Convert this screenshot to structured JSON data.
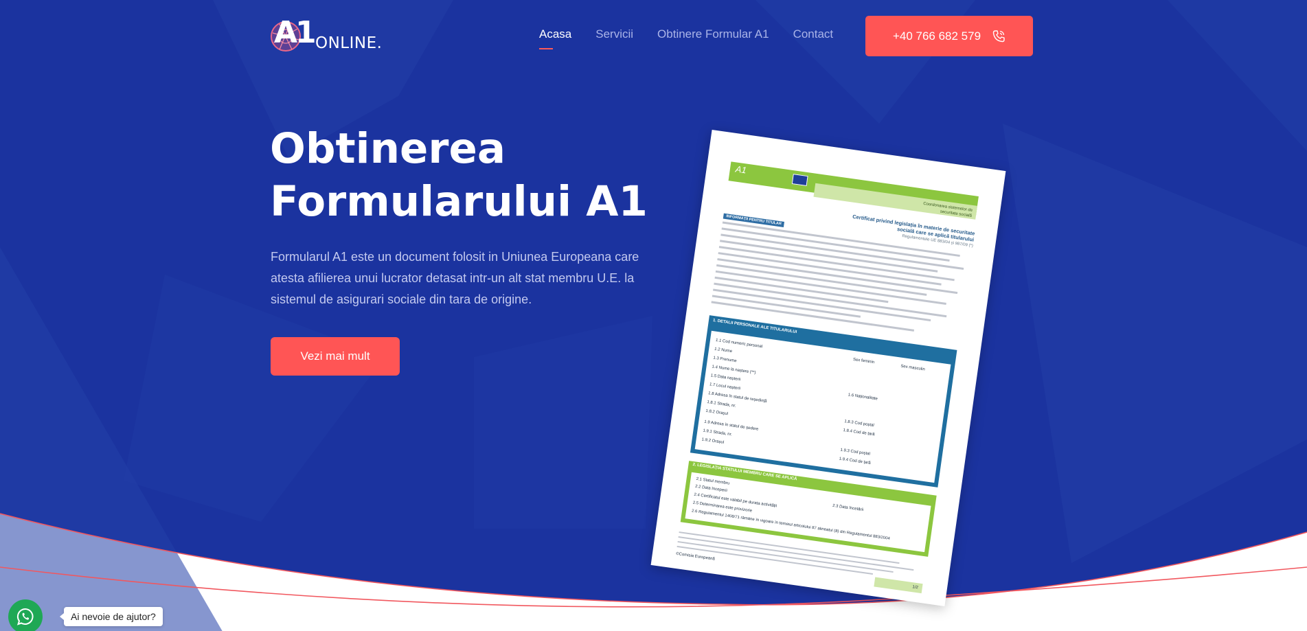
{
  "brand": {
    "logo_main": "A1",
    "logo_sub": "ONLINE."
  },
  "nav": {
    "items": [
      {
        "label": "Acasa",
        "active": true
      },
      {
        "label": "Servicii",
        "active": false
      },
      {
        "label": "Obtinere Formular A1",
        "active": false
      },
      {
        "label": "Contact",
        "active": false
      }
    ]
  },
  "header": {
    "phone": "+40 766 682 579",
    "phone_icon": "phone-icon"
  },
  "hero": {
    "title_line1": "Obtinerea",
    "title_line2": "Formularului A1",
    "description": "Formularul A1 este un document folosit in Uniunea Europeana care atesta afilierea unui lucrator detasat intr-un alt stat membru U.E. la sistemul de asigurari sociale din tara de origine.",
    "cta": "Vezi mai mult"
  },
  "document": {
    "form_code": "A1",
    "coord": "Coordonarea sistemelor de securitate socială",
    "title": "Certificat privind legislația în materie de securitate socială care se aplică titularului",
    "regulation": "Regulamentele UE 883/04 și 987/09 (*)",
    "info_label": "INFORMAȚII PENTRU TITULAR",
    "section1": "1. DETALII PERSONALE ALE TITULARULUI",
    "section1_fields": [
      "1.1 Cod numeric personal",
      "1.2 Nume",
      "1.3 Prenume",
      "1.4 Nume la naștere (**)",
      "1.5 Data nașterii",
      "1.7 Locul nașterii",
      "1.8 Adresa în statul de reședință",
      "1.8.1 Strada, nr.",
      "1.8.2 Orașul",
      "1.9 Adresa în statul de ședere",
      "1.9.1 Strada, nr.",
      "1.9.2 Orașul"
    ],
    "section1_right": [
      "Sex feminin",
      "Sex masculin",
      "1.6 Naționalitate",
      "1.8.3 Cod poștal",
      "1.8.4 Cod de țară",
      "1.9.3 Cod poștal",
      "1.9.4 Cod de țară"
    ],
    "section2": "2. LEGISLAȚIA STATULUI MEMBRU CARE SE APLICĂ",
    "section2_fields": [
      "2.1 Statul membru",
      "2.2 Data începerii",
      "2.3 Data încetării",
      "2.4 Certificatul este valabil pe durata activității",
      "2.5 Determinarea este provizorie",
      "2.6 Regulamentul 1408/71 rămâne în vigoare în temeiul articolului 87 alineatul (8) din Regulamentul 883/2004"
    ],
    "footer_sign": "©Comisia Europeană",
    "page": "1/2"
  },
  "whatsapp": {
    "tooltip": "Ai nevoie de ajutor?",
    "icon": "whatsapp-icon"
  },
  "colors": {
    "hero_bg": "#1b339f",
    "accent": "#ff5555",
    "whatsapp": "#1fa855"
  }
}
